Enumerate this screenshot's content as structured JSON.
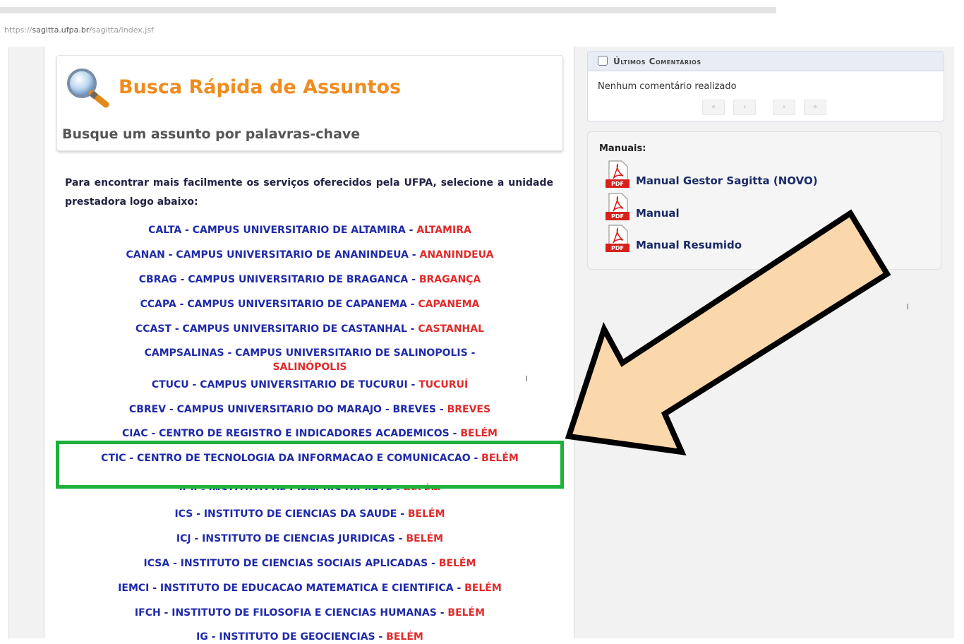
{
  "browser": {
    "url_prefix": "https://",
    "url_host": "sagitta.ufpa.br",
    "url_path": "/sagitta/index.jsf"
  },
  "search": {
    "title": "Busca Rápida de Assuntos",
    "subtitle": "Busque um assunto por palavras-chave",
    "intro": "Para encontrar mais facilmente os serviços oferecidos pela UFPA, selecione a unidade prestadora logo abaixo:"
  },
  "units": [
    {
      "name": "CALTA - CAMPUS UNIVERSITARIO DE ALTAMIRA",
      "city": "ALTAMIRA"
    },
    {
      "name": "CANAN - CAMPUS UNIVERSITARIO DE ANANINDEUA",
      "city": "ANANINDEUA"
    },
    {
      "name": "CBRAG - CAMPUS UNIVERSITARIO DE BRAGANCA",
      "city": "BRAGANÇA"
    },
    {
      "name": "CCAPA - CAMPUS UNIVERSITARIO DE CAPANEMA",
      "city": "CAPANEMA"
    },
    {
      "name": "CCAST - CAMPUS UNIVERSITARIO DE CASTANHAL",
      "city": "CASTANHAL"
    },
    {
      "name": "CAMPSALINAS - CAMPUS UNIVERSITARIO DE SALINOPOLIS",
      "city": "SALINÓPOLIS"
    },
    {
      "name": "CTUCU - CAMPUS UNIVERSITARIO DE TUCURUI",
      "city": "TUCURUÍ"
    },
    {
      "name": "CBREV - CAMPUS UNIVERSITARIO DO MARAJO - BREVES",
      "city": "BREVES"
    },
    {
      "name": "CIAC - CENTRO DE REGISTRO E INDICADORES ACADEMICOS",
      "city": "BELÉM"
    },
    {
      "name": "CTIC - CENTRO DE TECNOLOGIA DA INFORMACAO E COMUNICACAO",
      "city": "BELÉM"
    },
    {
      "name": "ICA - INSTITUTO DE CIENCIAS DA ARTE",
      "city": "BELÉM"
    },
    {
      "name": "ICS - INSTITUTO DE CIENCIAS DA SAUDE",
      "city": "BELÉM"
    },
    {
      "name": "ICJ - INSTITUTO DE CIENCIAS JURIDICAS",
      "city": "BELÉM"
    },
    {
      "name": "ICSA - INSTITUTO DE CIENCIAS SOCIAIS APLICADAS",
      "city": "BELÉM"
    },
    {
      "name": "IEMCI - INSTITUTO DE EDUCACAO MATEMATICA E CIENTIFICA",
      "city": "BELÉM"
    },
    {
      "name": "IFCH - INSTITUTO DE FILOSOFIA E CIENCIAS HUMANAS",
      "city": "BELÉM"
    },
    {
      "name": "IG - INSTITUTO DE GEOCIENCIAS",
      "city": "BELÉM"
    }
  ],
  "unit_separator": " - ",
  "comments": {
    "title": "Últimos Comentários",
    "empty": "Nenhum comentário realizado",
    "pager": [
      "«",
      "‹",
      "›",
      "»"
    ]
  },
  "manuals": {
    "title": "Manuais:",
    "pdf_badge": "PDF",
    "items": [
      "Manual Gestor Sagitta (NOVO)",
      "Manual",
      "Manual Resumido"
    ]
  },
  "colors": {
    "title_orange": "#f08c1e",
    "unit_blue": "#1f2aa8",
    "city_red": "#e02b2b",
    "highlight_green": "#1fb03a",
    "arrow_fill": "#fbd7ac"
  }
}
